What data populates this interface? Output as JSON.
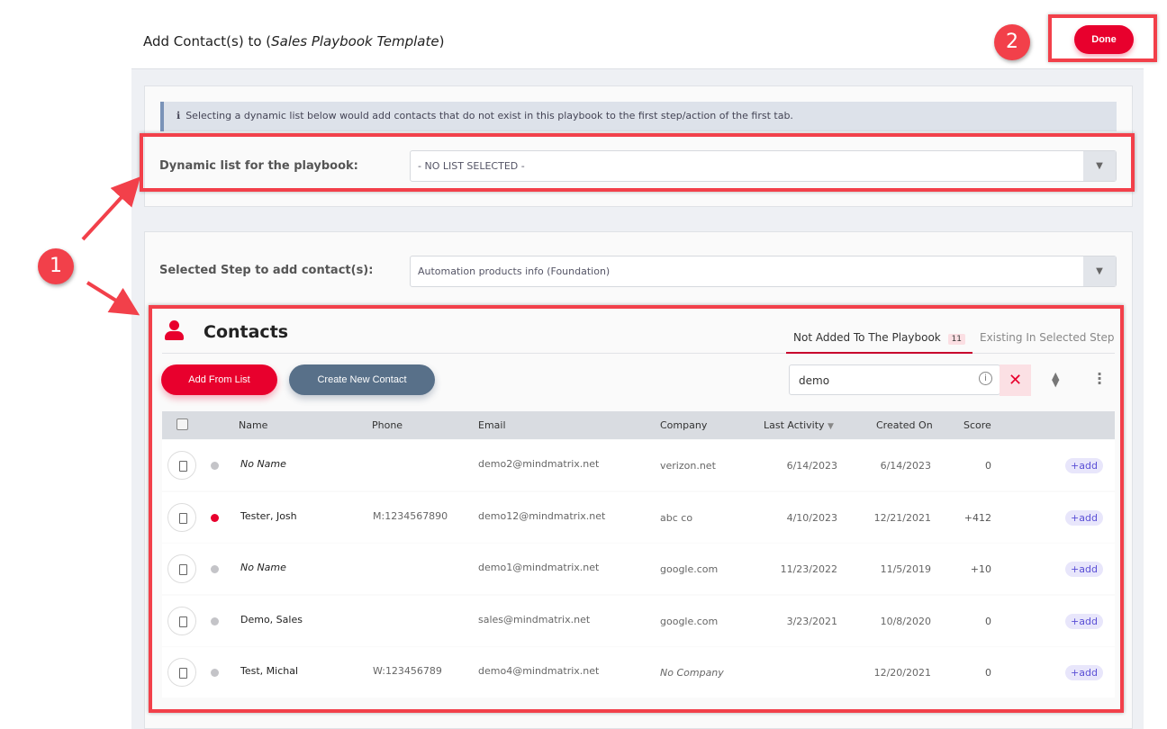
{
  "header": {
    "title_prefix": "Add Contact(s) to (",
    "playbook_name": "Sales Playbook Template",
    "title_suffix": ")",
    "done_label": "Done"
  },
  "info_text": "Selecting a dynamic list below would add contacts that do not exist in this playbook to the first step/action of the first tab.",
  "dynamic_list": {
    "label": "Dynamic list for the playbook:",
    "value": "- NO LIST SELECTED -"
  },
  "step": {
    "label": "Selected Step to add contact(s):",
    "value": "Automation products info (Foundation)"
  },
  "contacts": {
    "title": "Contacts",
    "tabs": [
      {
        "label": "Not Added To The Playbook",
        "count": "11",
        "active": true
      },
      {
        "label": "Existing In Selected Step"
      }
    ],
    "add_from_list": "Add From List",
    "create_new": "Create New Contact",
    "search_value": "demo",
    "columns": [
      "Name",
      "Phone",
      "Email",
      "Company",
      "Last Activity",
      "Created On",
      "Score"
    ],
    "add_label": "add",
    "rows": [
      {
        "name": "No Name",
        "italic": true,
        "phone": "",
        "email": "demo2@mindmatrix.net",
        "company": "verizon.net",
        "last": "6/14/2023",
        "created": "6/14/2023",
        "score": "0",
        "status": "#c4c4c8"
      },
      {
        "name": "Tester, Josh",
        "phone": "M:1234567890",
        "email": "demo12@mindmatrix.net",
        "company": "abc co",
        "last": "4/10/2023",
        "created": "12/21/2021",
        "score": "+412",
        "status": "#e8002d"
      },
      {
        "name": "No Name",
        "italic": true,
        "phone": "",
        "email": "demo1@mindmatrix.net",
        "company": "google.com",
        "last": "11/23/2022",
        "created": "11/5/2019",
        "score": "+10",
        "status": "#c4c4c8"
      },
      {
        "name": "Demo, Sales",
        "phone": "",
        "email": "sales@mindmatrix.net",
        "company": "google.com",
        "last": "3/23/2021",
        "created": "10/8/2020",
        "score": "0",
        "status": "#c4c4c8"
      },
      {
        "name": "Test, Michal",
        "phone": "W:123456789",
        "email": "demo4@mindmatrix.net",
        "company": "No Company",
        "company_italic": true,
        "last": "",
        "created": "12/20/2021",
        "score": "0",
        "status": "#c4c4c8"
      }
    ]
  },
  "annotations": {
    "one": "1",
    "two": "2"
  },
  "colors": {
    "accent": "#e8002d",
    "secondary_button": "#587089",
    "annotation": "#f2404a"
  }
}
